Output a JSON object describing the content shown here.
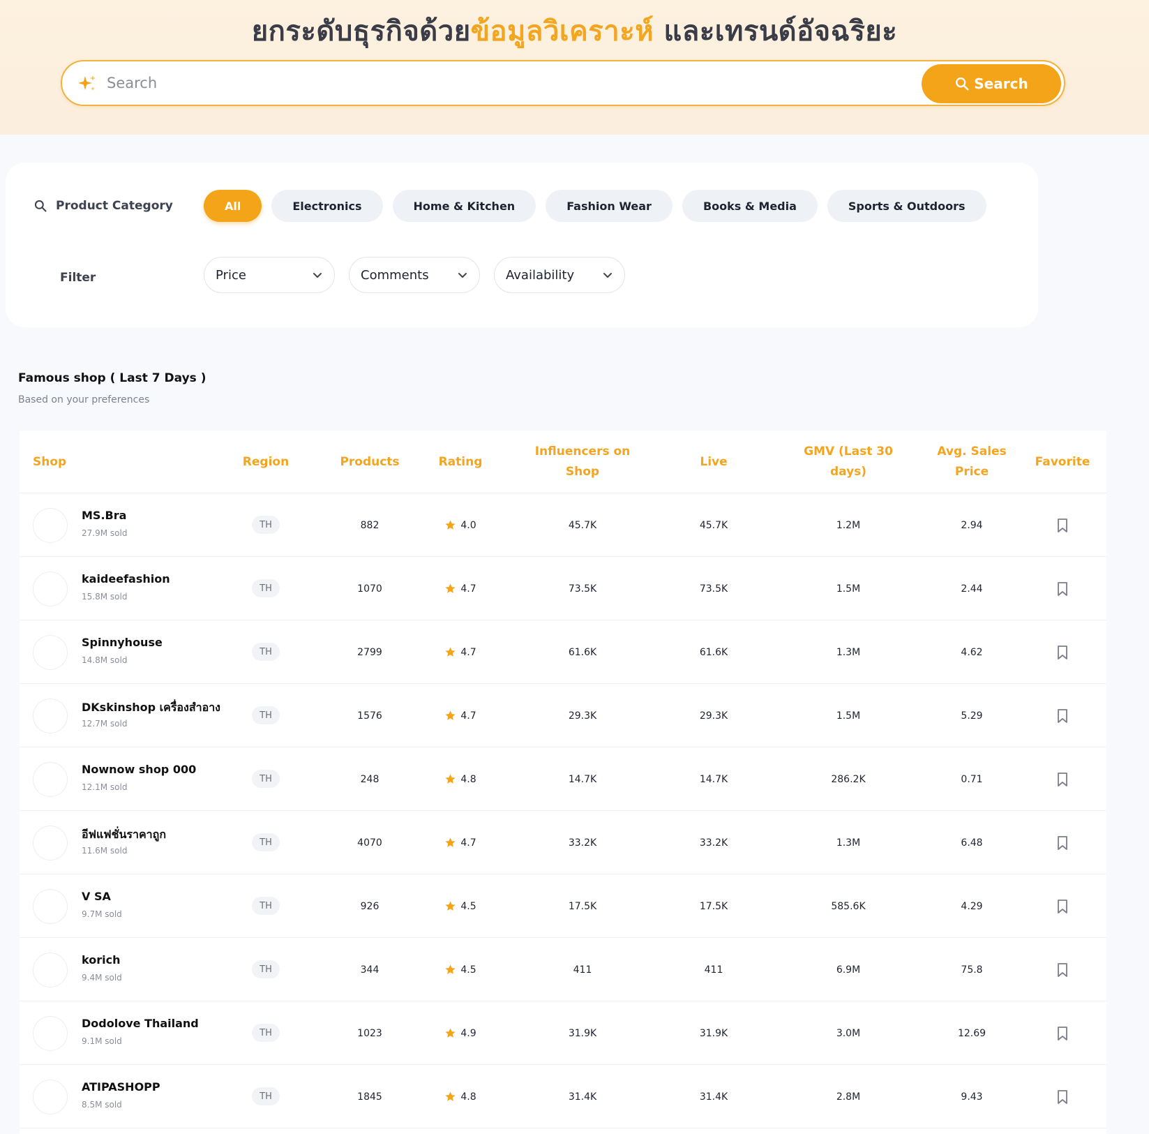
{
  "hero": {
    "title_part1": "ยกระดับธุรกิจด้วย",
    "title_accent": "ข้อมูลวิเคราะห์",
    "title_part2": " และเทรนด์อัจฉริยะ"
  },
  "search": {
    "placeholder": "Search",
    "value": "",
    "button_label": "Search"
  },
  "filters": {
    "category_label": "Product Category",
    "categories": [
      {
        "label": "All",
        "active": true
      },
      {
        "label": "Electronics",
        "active": false
      },
      {
        "label": "Home & Kitchen",
        "active": false
      },
      {
        "label": "Fashion Wear",
        "active": false
      },
      {
        "label": "Books & Media",
        "active": false
      },
      {
        "label": "Sports & Outdoors",
        "active": false
      }
    ],
    "filter_label": "Filter",
    "dropdowns": [
      "Price",
      "Comments",
      "Availability"
    ]
  },
  "section": {
    "title": "Famous shop ( Last 7 Days )",
    "subtitle": "Based on your preferences"
  },
  "table": {
    "headers": {
      "shop": "Shop",
      "region": "Region",
      "products": "Products",
      "rating": "Rating",
      "influencers": "Influencers on Shop",
      "live": "Live",
      "gmv": "GMV (Last 30 days)",
      "avg_price": "Avg. Sales Price",
      "favorite": "Favorite"
    },
    "rows": [
      {
        "name": "MS.Bra",
        "sold": "27.9M sold",
        "region": "TH",
        "products": "882",
        "rating": "4.0",
        "influencers": "45.7K",
        "live": "45.7K",
        "gmv": "1.2M",
        "avg_price": "2.94"
      },
      {
        "name": "kaideefashion",
        "sold": "15.8M sold",
        "region": "TH",
        "products": "1070",
        "rating": "4.7",
        "influencers": "73.5K",
        "live": "73.5K",
        "gmv": "1.5M",
        "avg_price": "2.44"
      },
      {
        "name": "Spinnyhouse",
        "sold": "14.8M sold",
        "region": "TH",
        "products": "2799",
        "rating": "4.7",
        "influencers": "61.6K",
        "live": "61.6K",
        "gmv": "1.3M",
        "avg_price": "4.62"
      },
      {
        "name": "DKskinshop เครื่องสำอาง",
        "sold": "12.7M sold",
        "region": "TH",
        "products": "1576",
        "rating": "4.7",
        "influencers": "29.3K",
        "live": "29.3K",
        "gmv": "1.5M",
        "avg_price": "5.29"
      },
      {
        "name": "Nownow shop 000",
        "sold": "12.1M sold",
        "region": "TH",
        "products": "248",
        "rating": "4.8",
        "influencers": "14.7K",
        "live": "14.7K",
        "gmv": "286.2K",
        "avg_price": "0.71"
      },
      {
        "name": "อีฟแฟชั่นราคาถูก",
        "sold": "11.6M sold",
        "region": "TH",
        "products": "4070",
        "rating": "4.7",
        "influencers": "33.2K",
        "live": "33.2K",
        "gmv": "1.3M",
        "avg_price": "6.48"
      },
      {
        "name": "V SA",
        "sold": "9.7M sold",
        "region": "TH",
        "products": "926",
        "rating": "4.5",
        "influencers": "17.5K",
        "live": "17.5K",
        "gmv": "585.6K",
        "avg_price": "4.29"
      },
      {
        "name": "korich",
        "sold": "9.4M sold",
        "region": "TH",
        "products": "344",
        "rating": "4.5",
        "influencers": "411",
        "live": "411",
        "gmv": "6.9M",
        "avg_price": "75.8"
      },
      {
        "name": "Dodolove Thailand",
        "sold": "9.1M sold",
        "region": "TH",
        "products": "1023",
        "rating": "4.9",
        "influencers": "31.9K",
        "live": "31.9K",
        "gmv": "3.0M",
        "avg_price": "12.69"
      },
      {
        "name": "ATIPASHOPP",
        "sold": "8.5M sold",
        "region": "TH",
        "products": "1845",
        "rating": "4.8",
        "influencers": "31.4K",
        "live": "31.4K",
        "gmv": "2.8M",
        "avg_price": "9.43"
      }
    ]
  },
  "colors": {
    "accent": "#f4a418",
    "header_text": "#f3a51f"
  },
  "icons": {
    "search_leading": "sparkle-icon",
    "search_button": "magnifier-icon",
    "category": "magnifier-icon",
    "dropdown": "chevron-down-icon",
    "rating": "star-icon",
    "favorite": "bookmark-icon"
  }
}
